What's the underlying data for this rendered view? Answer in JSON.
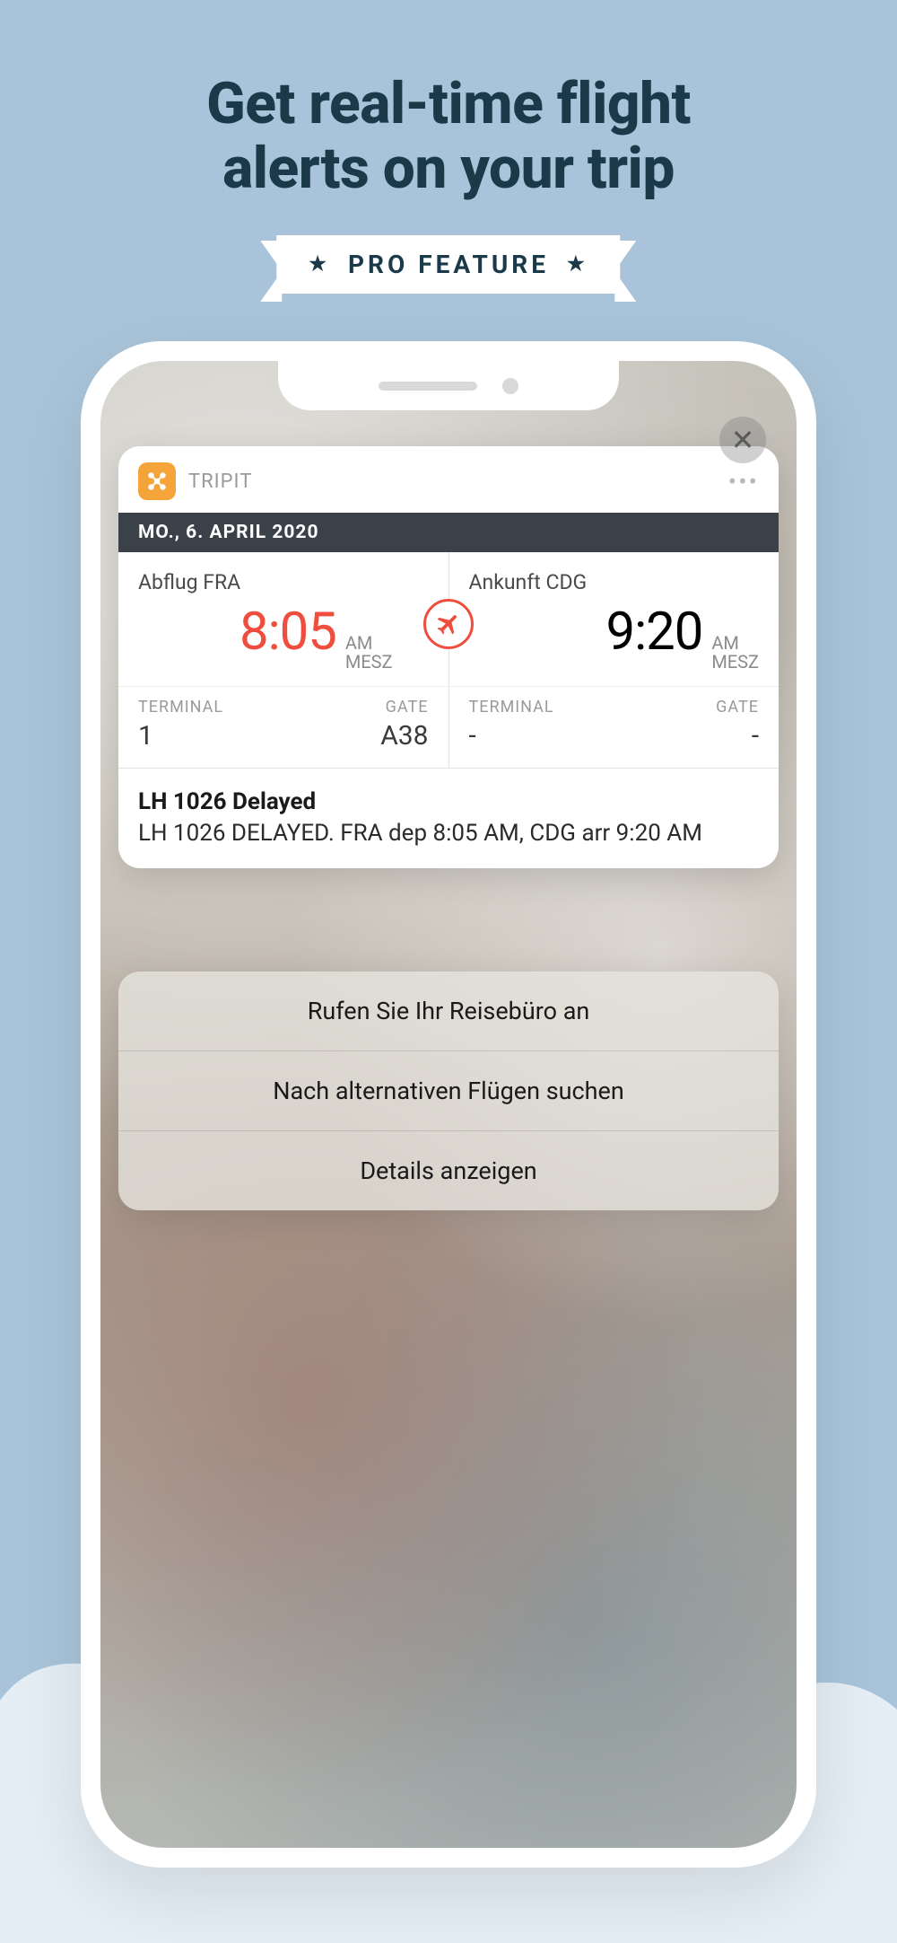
{
  "headline_line1": "Get real-time flight",
  "headline_line2": "alerts on your trip",
  "ribbon_label": "PRO FEATURE",
  "notification": {
    "app_name": "TRIPIT",
    "date": "MO., 6. APRIL 2020",
    "departure": {
      "label": "Abflug FRA",
      "time": "8:05",
      "ampm": "AM",
      "tz": "MESZ",
      "terminal_label": "TERMINAL",
      "terminal_value": "1",
      "gate_label": "GATE",
      "gate_value": "A38"
    },
    "arrival": {
      "label": "Ankunft CDG",
      "time": "9:20",
      "ampm": "AM",
      "tz": "MESZ",
      "terminal_label": "TERMINAL",
      "terminal_value": "-",
      "gate_label": "GATE",
      "gate_value": "-"
    },
    "delay": {
      "title": "LH 1026 Delayed",
      "body": "LH 1026 DELAYED. FRA  dep 8:05 AM, CDG  arr 9:20 AM"
    }
  },
  "actions": [
    "Rufen Sie Ihr Reisebüro an",
    "Nach alternativen Flügen suchen",
    "Details anzeigen"
  ]
}
